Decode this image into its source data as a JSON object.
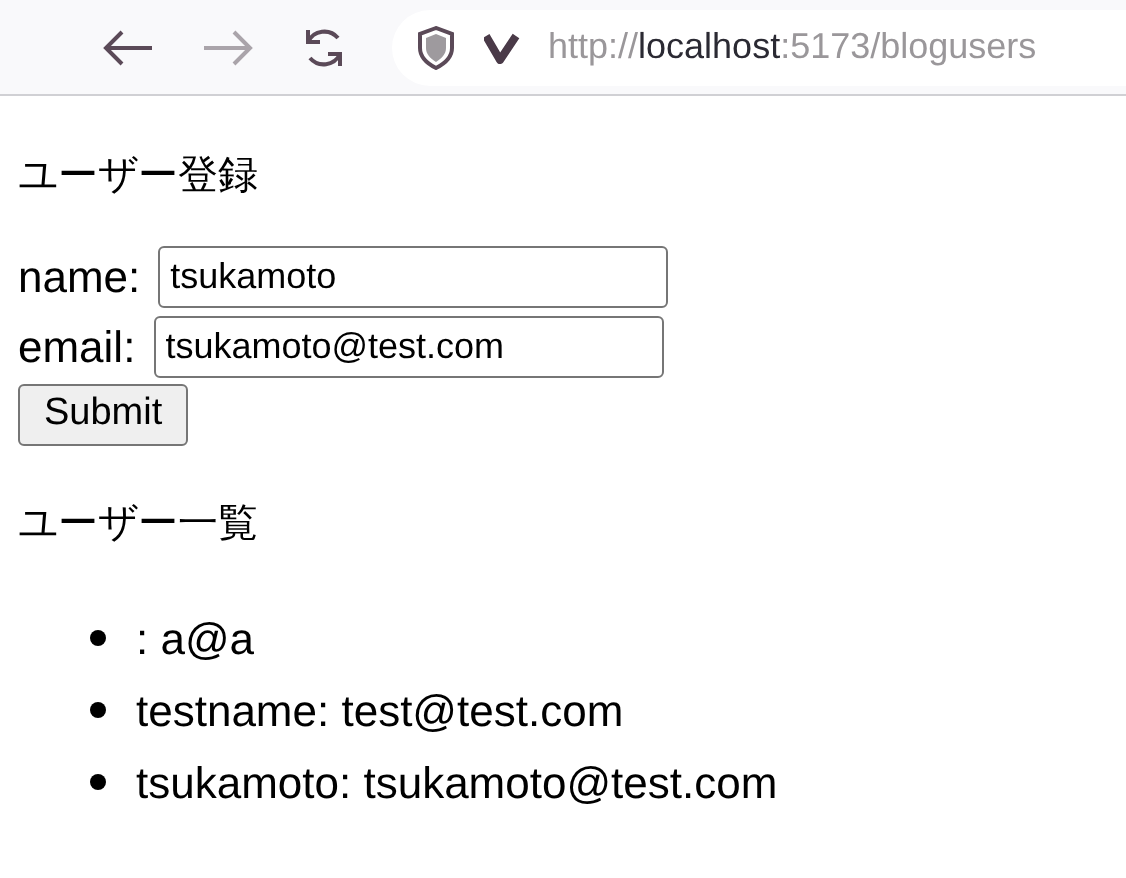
{
  "browser": {
    "url_scheme": "http://",
    "url_host": "localhost",
    "url_rest": ":5173/blogusers"
  },
  "register": {
    "heading": "ユーザー登録",
    "fields": [
      {
        "label": "name:",
        "value": "tsukamoto"
      },
      {
        "label": "email:",
        "value": "tsukamoto@test.com"
      }
    ],
    "submit": "Submit"
  },
  "users": {
    "heading": "ユーザー一覧",
    "items": [
      ": a@a",
      "testname: test@test.com",
      "tsukamoto: tsukamoto@test.com"
    ]
  }
}
